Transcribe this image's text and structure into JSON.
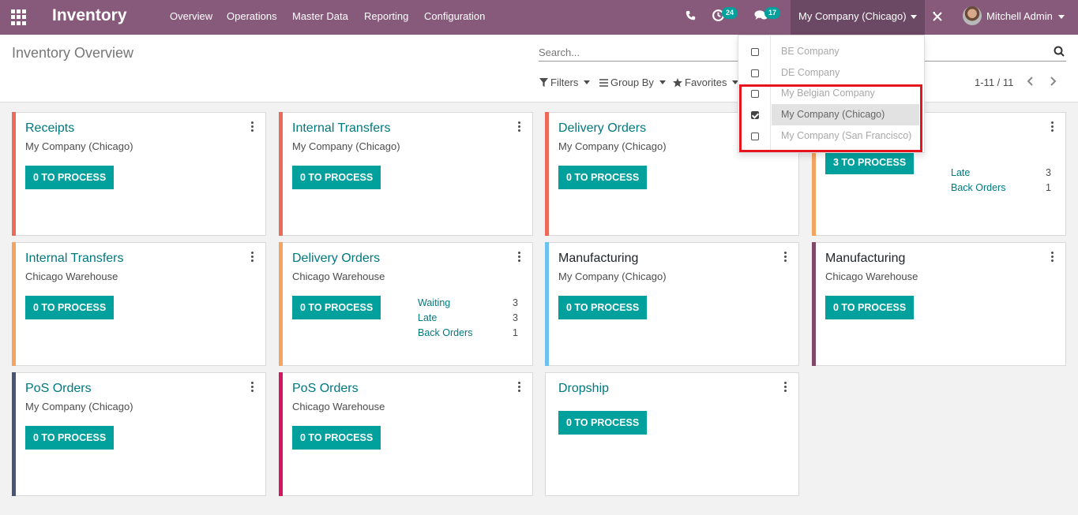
{
  "nav": {
    "app_title": "Inventory",
    "menu": [
      "Overview",
      "Operations",
      "Master Data",
      "Reporting",
      "Configuration"
    ],
    "activity_count": "24",
    "message_count": "17",
    "current_company": "My Company (Chicago)",
    "user_name": "Mitchell Admin"
  },
  "control": {
    "breadcrumb": "Inventory Overview",
    "search_placeholder": "Search...",
    "filters": "Filters",
    "group_by": "Group By",
    "favorites": "Favorites",
    "pager": "1-11 / 11"
  },
  "company_dropdown": [
    {
      "label": "BE Company",
      "checked": false
    },
    {
      "label": "DE Company",
      "checked": false
    },
    {
      "label": "My Belgian Company",
      "checked": false
    },
    {
      "label": "My Company (Chicago)",
      "checked": true
    },
    {
      "label": "My Company (San Francisco)",
      "checked": false
    }
  ],
  "cards": [
    {
      "title": "Receipts",
      "subtitle": "My Company (Chicago)",
      "button": "0 TO PROCESS",
      "color": "#ed6a5a",
      "stats": []
    },
    {
      "title": "Internal Transfers",
      "subtitle": "My Company (Chicago)",
      "button": "0 TO PROCESS",
      "color": "#ed6a5a",
      "stats": []
    },
    {
      "title": "Delivery Orders",
      "subtitle": "My Company (Chicago)",
      "button": "0 TO PROCESS",
      "color": "#ed6a5a",
      "stats": []
    },
    {
      "title": "",
      "subtitle": "",
      "button": "3 TO PROCESS",
      "color": "#f4a460",
      "stats": [
        {
          "label": "Late",
          "value": "3"
        },
        {
          "label": "Back Orders",
          "value": "1"
        }
      ]
    },
    {
      "title": "Internal Transfers",
      "subtitle": "Chicago Warehouse",
      "button": "0 TO PROCESS",
      "color": "#f4a460",
      "stats": []
    },
    {
      "title": "Delivery Orders",
      "subtitle": "Chicago Warehouse",
      "button": "0 TO PROCESS",
      "color": "#f4a460",
      "stats": [
        {
          "label": "Waiting",
          "value": "3"
        },
        {
          "label": "Late",
          "value": "3"
        },
        {
          "label": "Back Orders",
          "value": "1"
        }
      ]
    },
    {
      "title": "Manufacturing",
      "subtitle": "My Company (Chicago)",
      "button": "0 TO PROCESS",
      "color": "#6cc1ed",
      "stats": []
    },
    {
      "title": "Manufacturing",
      "subtitle": "Chicago Warehouse",
      "button": "0 TO PROCESS",
      "color": "#814968",
      "stats": []
    },
    {
      "title": "PoS Orders",
      "subtitle": "My Company (Chicago)",
      "button": "0 TO PROCESS",
      "color": "#475577",
      "stats": []
    },
    {
      "title": "PoS Orders",
      "subtitle": "Chicago Warehouse",
      "button": "0 TO PROCESS",
      "color": "#d6145f",
      "stats": []
    },
    {
      "title": "Dropship",
      "subtitle": "",
      "button": "0 TO PROCESS",
      "color": "",
      "stats": []
    }
  ]
}
